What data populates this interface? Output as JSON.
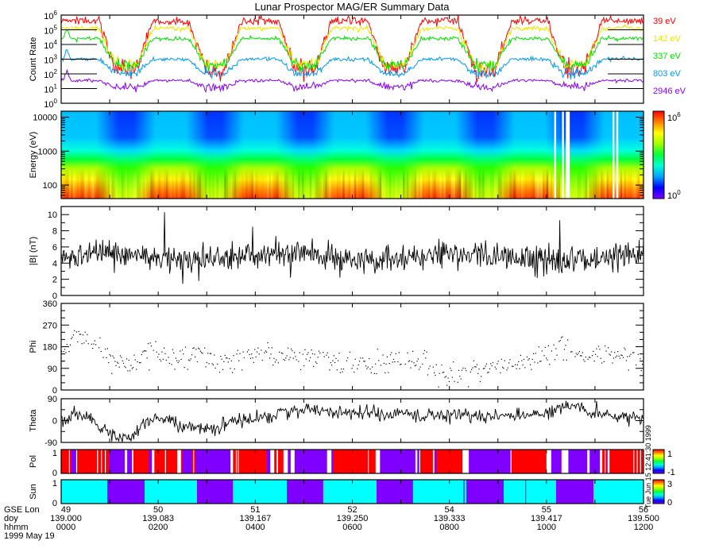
{
  "title": "Lunar Prospector MAG/ER Summary Data",
  "timestamp": "Tue Jun 15 12:41:30 1999",
  "time_axis": {
    "row_labels": [
      "GSE Lon",
      "doy",
      "hhmm",
      "1999 May 19"
    ],
    "range_hours": [
      0,
      12
    ],
    "ticks": [
      {
        "hours": 0,
        "gse_lon": "49",
        "doy": "139.000",
        "hhmm": "0000"
      },
      {
        "hours": 2,
        "gse_lon": "50",
        "doy": "139.083",
        "hhmm": "0200"
      },
      {
        "hours": 4,
        "gse_lon": "51",
        "doy": "139.167",
        "hhmm": "0400"
      },
      {
        "hours": 6,
        "gse_lon": "52",
        "doy": "139.250",
        "hhmm": "0600"
      },
      {
        "hours": 8,
        "gse_lon": "54",
        "doy": "139.333",
        "hhmm": "0800"
      },
      {
        "hours": 10,
        "gse_lon": "55",
        "doy": "139.417",
        "hhmm": "1000"
      },
      {
        "hours": 12,
        "gse_lon": "56",
        "doy": "139.500",
        "hhmm": "1200"
      }
    ]
  },
  "chart_data": [
    {
      "id": "count-rate",
      "type": "line",
      "ylabel": "Count Rate",
      "yscale": "log",
      "ylim": [
        1,
        1000000
      ],
      "ytick_labels": [
        {
          "base": "10",
          "exp": "0"
        },
        {
          "base": "10",
          "exp": "1"
        },
        {
          "base": "10",
          "exp": "2"
        },
        {
          "base": "10",
          "exp": "3"
        },
        {
          "base": "10",
          "exp": "4"
        },
        {
          "base": "10",
          "exp": "5"
        },
        {
          "base": "10",
          "exp": "6"
        }
      ],
      "series": [
        {
          "name": "39 eV",
          "color": "#ff0000",
          "sunlit_log10": 5.6,
          "shadow_log10": 2.3,
          "noise_log10": 0.13
        },
        {
          "name": "142 eV",
          "color": "#e8e800",
          "sunlit_log10": 5.1,
          "shadow_log10": 2.6,
          "noise_log10": 0.08
        },
        {
          "name": "337 eV",
          "color": "#00e000",
          "sunlit_log10": 4.4,
          "shadow_log10": 2.6,
          "noise_log10": 0.07
        },
        {
          "name": "803 eV",
          "color": "#0099ff",
          "sunlit_log10": 3.0,
          "shadow_log10": 2.0,
          "noise_log10": 0.06
        },
        {
          "name": "2946 eV",
          "color": "#8800ff",
          "sunlit_log10": 1.55,
          "shadow_log10": 1.1,
          "noise_log10": 0.05
        }
      ]
    },
    {
      "id": "energy-spectrogram",
      "type": "heatmap",
      "ylabel": "Energy (eV)",
      "yscale": "log",
      "ylim": [
        40,
        15000
      ],
      "ytick_labels": [
        "100",
        "1000",
        "10000"
      ],
      "colorbar": {
        "scale": "log",
        "max_label": {
          "base": "10",
          "exp": "6"
        },
        "min_label": {
          "base": "10",
          "exp": "0"
        }
      },
      "data_gaps_hours": [
        10.15,
        10.33,
        10.42,
        11.35,
        11.45
      ]
    },
    {
      "id": "field-magnitude",
      "type": "line",
      "ylabel": "|B| (nT)",
      "ylim": [
        0,
        11
      ],
      "ytick_labels": [
        "0",
        "2",
        "4",
        "6",
        "8",
        "10"
      ],
      "mean": 4.8,
      "noise_sd": 0.85,
      "notable_points": [
        [
          2.13,
          10.3
        ],
        [
          3.95,
          8.5
        ],
        [
          10.28,
          9.3
        ],
        [
          2.83,
          1.8
        ],
        [
          4.72,
          2.2
        ],
        [
          10.0,
          2.6
        ]
      ]
    },
    {
      "id": "field-phi",
      "type": "scatter",
      "ylabel": "Phi",
      "ylim": [
        0,
        360
      ],
      "ytick_labels": [
        "0",
        "90",
        "180",
        "270",
        "360"
      ],
      "trend": [
        [
          0,
          110
        ],
        [
          0.3,
          240
        ],
        [
          0.7,
          200
        ],
        [
          1.1,
          110
        ],
        [
          1.5,
          100
        ],
        [
          1.8,
          150
        ],
        [
          2.3,
          140
        ],
        [
          3,
          130
        ],
        [
          3.5,
          120
        ],
        [
          4,
          160
        ],
        [
          4.6,
          140
        ],
        [
          5,
          140
        ],
        [
          5.6,
          120
        ],
        [
          6.3,
          100
        ],
        [
          7,
          130
        ],
        [
          7.5,
          110
        ],
        [
          8,
          60
        ],
        [
          8.6,
          90
        ],
        [
          9.2,
          100
        ],
        [
          9.8,
          130
        ],
        [
          10.3,
          190
        ],
        [
          10.8,
          130
        ],
        [
          11.3,
          160
        ],
        [
          12,
          140
        ]
      ],
      "scatter_sd": 25
    },
    {
      "id": "field-theta",
      "type": "line",
      "ylabel": "Theta",
      "ylim": [
        -90,
        90
      ],
      "ytick_labels": [
        "-90",
        "0",
        "90"
      ],
      "trend": [
        [
          0,
          0
        ],
        [
          0.3,
          30
        ],
        [
          0.6,
          10
        ],
        [
          0.9,
          -30
        ],
        [
          1.1,
          -75
        ],
        [
          1.5,
          -60
        ],
        [
          1.75,
          0
        ],
        [
          2.1,
          15
        ],
        [
          2.5,
          -25
        ],
        [
          3,
          -35
        ],
        [
          3.5,
          0
        ],
        [
          4,
          10
        ],
        [
          4.5,
          30
        ],
        [
          5,
          45
        ],
        [
          6,
          30
        ],
        [
          7,
          25
        ],
        [
          8,
          20
        ],
        [
          9,
          15
        ],
        [
          10,
          30
        ],
        [
          10.55,
          60
        ],
        [
          11,
          30
        ],
        [
          12,
          10
        ]
      ],
      "noise_sd": 14
    },
    {
      "id": "polarity",
      "type": "heatmap",
      "ylabel": "Pol",
      "ytick_labels": [
        "0",
        "1"
      ],
      "colors": {
        "positive": "#ff0000",
        "negative": "#8000ff",
        "gap": "#ffffff"
      },
      "colorbar": {
        "max_label": "1",
        "min_label": "-1"
      },
      "negative_intervals_hours": [
        [
          0.21,
          0.31
        ],
        [
          0.98,
          1.46
        ],
        [
          1.8,
          1.87
        ],
        [
          2.5,
          2.7
        ],
        [
          2.77,
          3.49
        ],
        [
          4.24,
          4.31
        ],
        [
          4.67,
          4.73
        ],
        [
          4.81,
          5.48
        ],
        [
          5.57,
          5.6
        ],
        [
          6.57,
          7.37
        ],
        [
          7.71,
          7.73
        ],
        [
          8.4,
          9.28
        ],
        [
          10.1,
          10.31
        ],
        [
          10.45,
          11.1
        ],
        [
          11.23,
          11.26
        ]
      ],
      "gap_intervals_hours": [
        [
          0.16,
          0.18
        ],
        [
          0.31,
          0.33
        ],
        [
          0.74,
          0.76
        ],
        [
          0.82,
          0.84
        ],
        [
          0.9,
          0.92
        ],
        [
          1.31,
          1.36
        ],
        [
          1.46,
          1.49
        ],
        [
          1.87,
          1.92
        ],
        [
          2.14,
          2.16
        ],
        [
          2.39,
          2.47
        ],
        [
          2.72,
          2.74
        ],
        [
          3.49,
          3.54
        ],
        [
          3.6,
          3.62
        ],
        [
          3.64,
          3.66
        ],
        [
          4.31,
          4.39
        ],
        [
          4.44,
          4.47
        ],
        [
          4.58,
          4.67
        ],
        [
          4.73,
          4.81
        ],
        [
          5.48,
          5.57
        ],
        [
          6.32,
          6.34
        ],
        [
          6.48,
          6.57
        ],
        [
          7.3,
          7.34
        ],
        [
          7.38,
          7.4
        ],
        [
          7.66,
          7.69
        ],
        [
          8.27,
          8.4
        ],
        [
          9.26,
          9.28
        ],
        [
          10.0,
          10.1
        ],
        [
          10.31,
          10.45
        ],
        [
          10.84,
          10.89
        ],
        [
          11.1,
          11.15
        ],
        [
          11.2,
          11.22
        ],
        [
          11.26,
          11.3
        ],
        [
          11.79,
          11.81
        ],
        [
          11.86,
          11.88
        ],
        [
          11.93,
          11.95
        ]
      ]
    },
    {
      "id": "sun",
      "type": "heatmap",
      "ylabel": "Sun",
      "ytick_labels": [
        "0",
        "1"
      ],
      "colors": {
        "sunlit": "#00ffff",
        "shadow": "#8000ff"
      },
      "colorbar": {
        "max_label": "3",
        "min_label": "0"
      },
      "shadow_intervals_hours": [
        [
          0.95,
          1.72
        ],
        [
          2.8,
          3.54
        ],
        [
          4.65,
          5.4
        ],
        [
          6.5,
          7.25
        ],
        [
          8.29,
          8.31
        ],
        [
          8.35,
          9.12
        ],
        [
          9.56,
          9.58
        ],
        [
          10.2,
          10.97
        ]
      ]
    }
  ]
}
